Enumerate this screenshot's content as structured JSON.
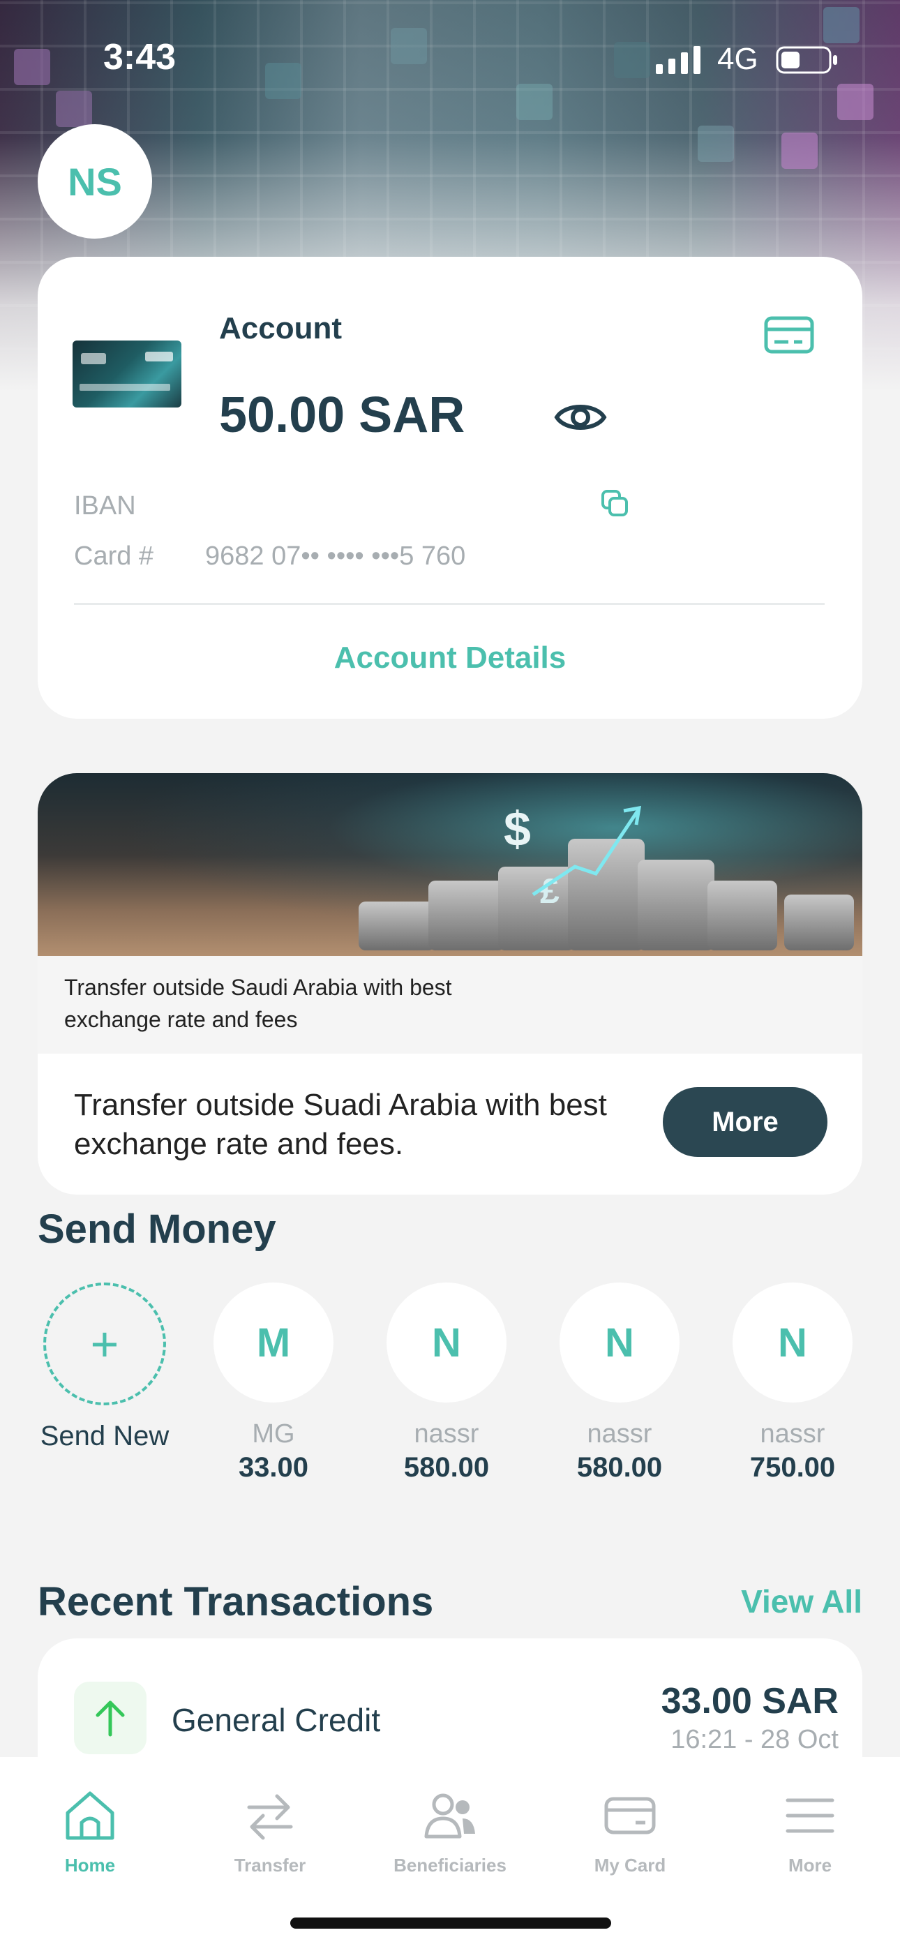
{
  "status_bar": {
    "time": "3:43",
    "network": "4G"
  },
  "profile": {
    "initials": "NS"
  },
  "account": {
    "label": "Account",
    "balance": "50.00 SAR",
    "iban_label": "IBAN",
    "card_label": "Card #",
    "card_number": "9682 07•• •••• •••5 760",
    "details_link": "Account Details"
  },
  "promo": {
    "caption": "Transfer outside Saudi Arabia with best exchange rate and fees",
    "text": "Transfer outside Suadi Arabia with best exchange rate and fees.",
    "more_button": "More"
  },
  "send_money": {
    "title": "Send Money",
    "send_new_label": "Send New",
    "contacts": [
      {
        "initial": "M",
        "name": "MG",
        "amount": "33.00"
      },
      {
        "initial": "N",
        "name": "nassr",
        "amount": "580.00"
      },
      {
        "initial": "N",
        "name": "nassr",
        "amount": "580.00"
      },
      {
        "initial": "N",
        "name": "nassr",
        "amount": "750.00"
      }
    ]
  },
  "recent_transactions": {
    "title": "Recent Transactions",
    "view_all": "View All",
    "items": [
      {
        "title": "General Credit",
        "amount": "33.00 SAR",
        "time": "16:21  - 28 Oct"
      }
    ]
  },
  "bottom_nav": {
    "items": [
      {
        "label": "Home",
        "icon": "home-icon",
        "active": true
      },
      {
        "label": "Transfer",
        "icon": "transfer-icon",
        "active": false
      },
      {
        "label": "Beneficiaries",
        "icon": "beneficiaries-icon",
        "active": false
      },
      {
        "label": "My Card",
        "icon": "card-icon",
        "active": false
      },
      {
        "label": "More",
        "icon": "menu-icon",
        "active": false
      }
    ]
  },
  "colors": {
    "accent": "#4bbfad",
    "primary_text": "#233f4d",
    "muted_text": "#a7adb1",
    "button_dark": "#2b4752",
    "credit_green": "#34c759"
  }
}
